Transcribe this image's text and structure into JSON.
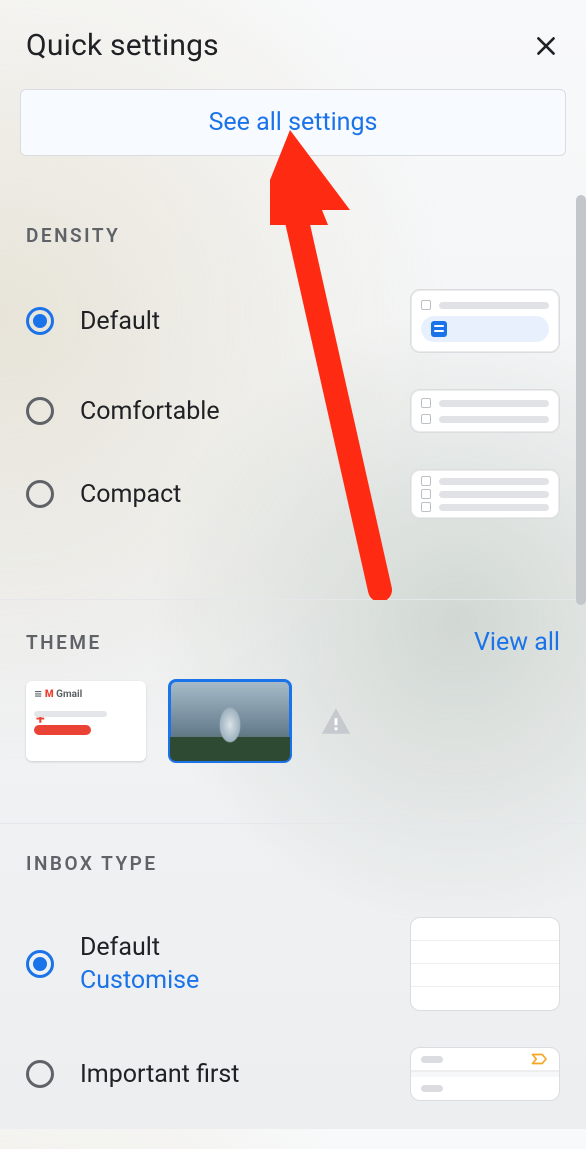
{
  "header": {
    "title": "Quick settings"
  },
  "see_all": {
    "label": "See all settings"
  },
  "density": {
    "title": "DENSITY",
    "options": [
      {
        "label": "Default",
        "selected": true
      },
      {
        "label": "Comfortable",
        "selected": false
      },
      {
        "label": "Compact",
        "selected": false
      }
    ]
  },
  "theme": {
    "title": "THEME",
    "view_all": "View all"
  },
  "inbox": {
    "title": "INBOX TYPE",
    "options": [
      {
        "label": "Default",
        "sub": "Customise",
        "selected": true
      },
      {
        "label": "Important first",
        "selected": false
      }
    ]
  }
}
